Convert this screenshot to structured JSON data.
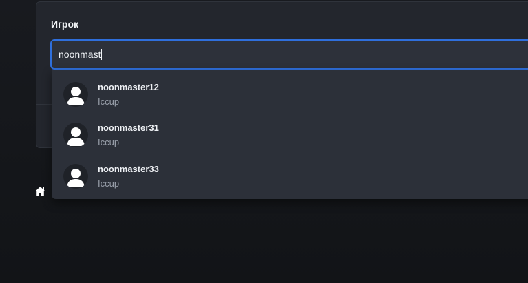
{
  "field": {
    "label": "Игрок",
    "value": "noonmast"
  },
  "suggestions": [
    {
      "name": "noonmaster12",
      "source": "Iccup",
      "icon": "user-avatar-icon"
    },
    {
      "name": "noonmaster31",
      "source": "Iccup",
      "icon": "user-avatar-icon"
    },
    {
      "name": "noonmaster33",
      "source": "Iccup",
      "icon": "user-avatar-icon"
    }
  ],
  "nav": {
    "home_icon": "home-icon"
  },
  "colors": {
    "background": "#15171b",
    "panel": "#23262d",
    "input_border_focus": "#2f6fdc",
    "dropdown": "#2c3039",
    "muted_text": "#9aa0ab"
  }
}
